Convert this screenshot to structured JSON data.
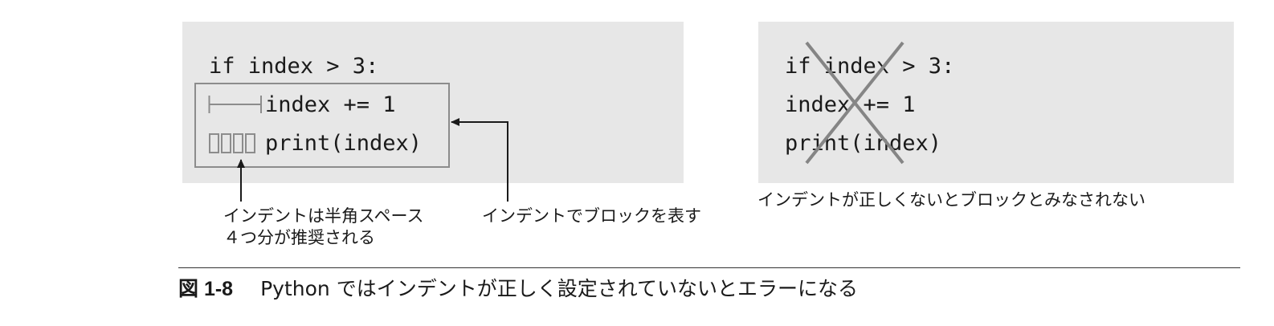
{
  "left_example": {
    "line1": "if index > 3:",
    "line2": "index += 1",
    "line3": "print(index)",
    "annotation_spaces": "インデントは半角スペース\n４つ分が推奨される",
    "annotation_block": "インデントでブロックを表す"
  },
  "right_example": {
    "line1": "if index > 3:",
    "line2": "index += 1",
    "line3": "print(index)",
    "annotation": "インデントが正しくないとブロックとみなされない"
  },
  "caption": {
    "number": "図 1-8",
    "text": "Python ではインデントが正しく設定されていないとエラーになる"
  },
  "icons": {
    "tab_marker": "tab-indent-icon",
    "space_marker": "space-indent-icon",
    "cross": "cross-mark-icon",
    "arrow": "arrow-icon"
  }
}
